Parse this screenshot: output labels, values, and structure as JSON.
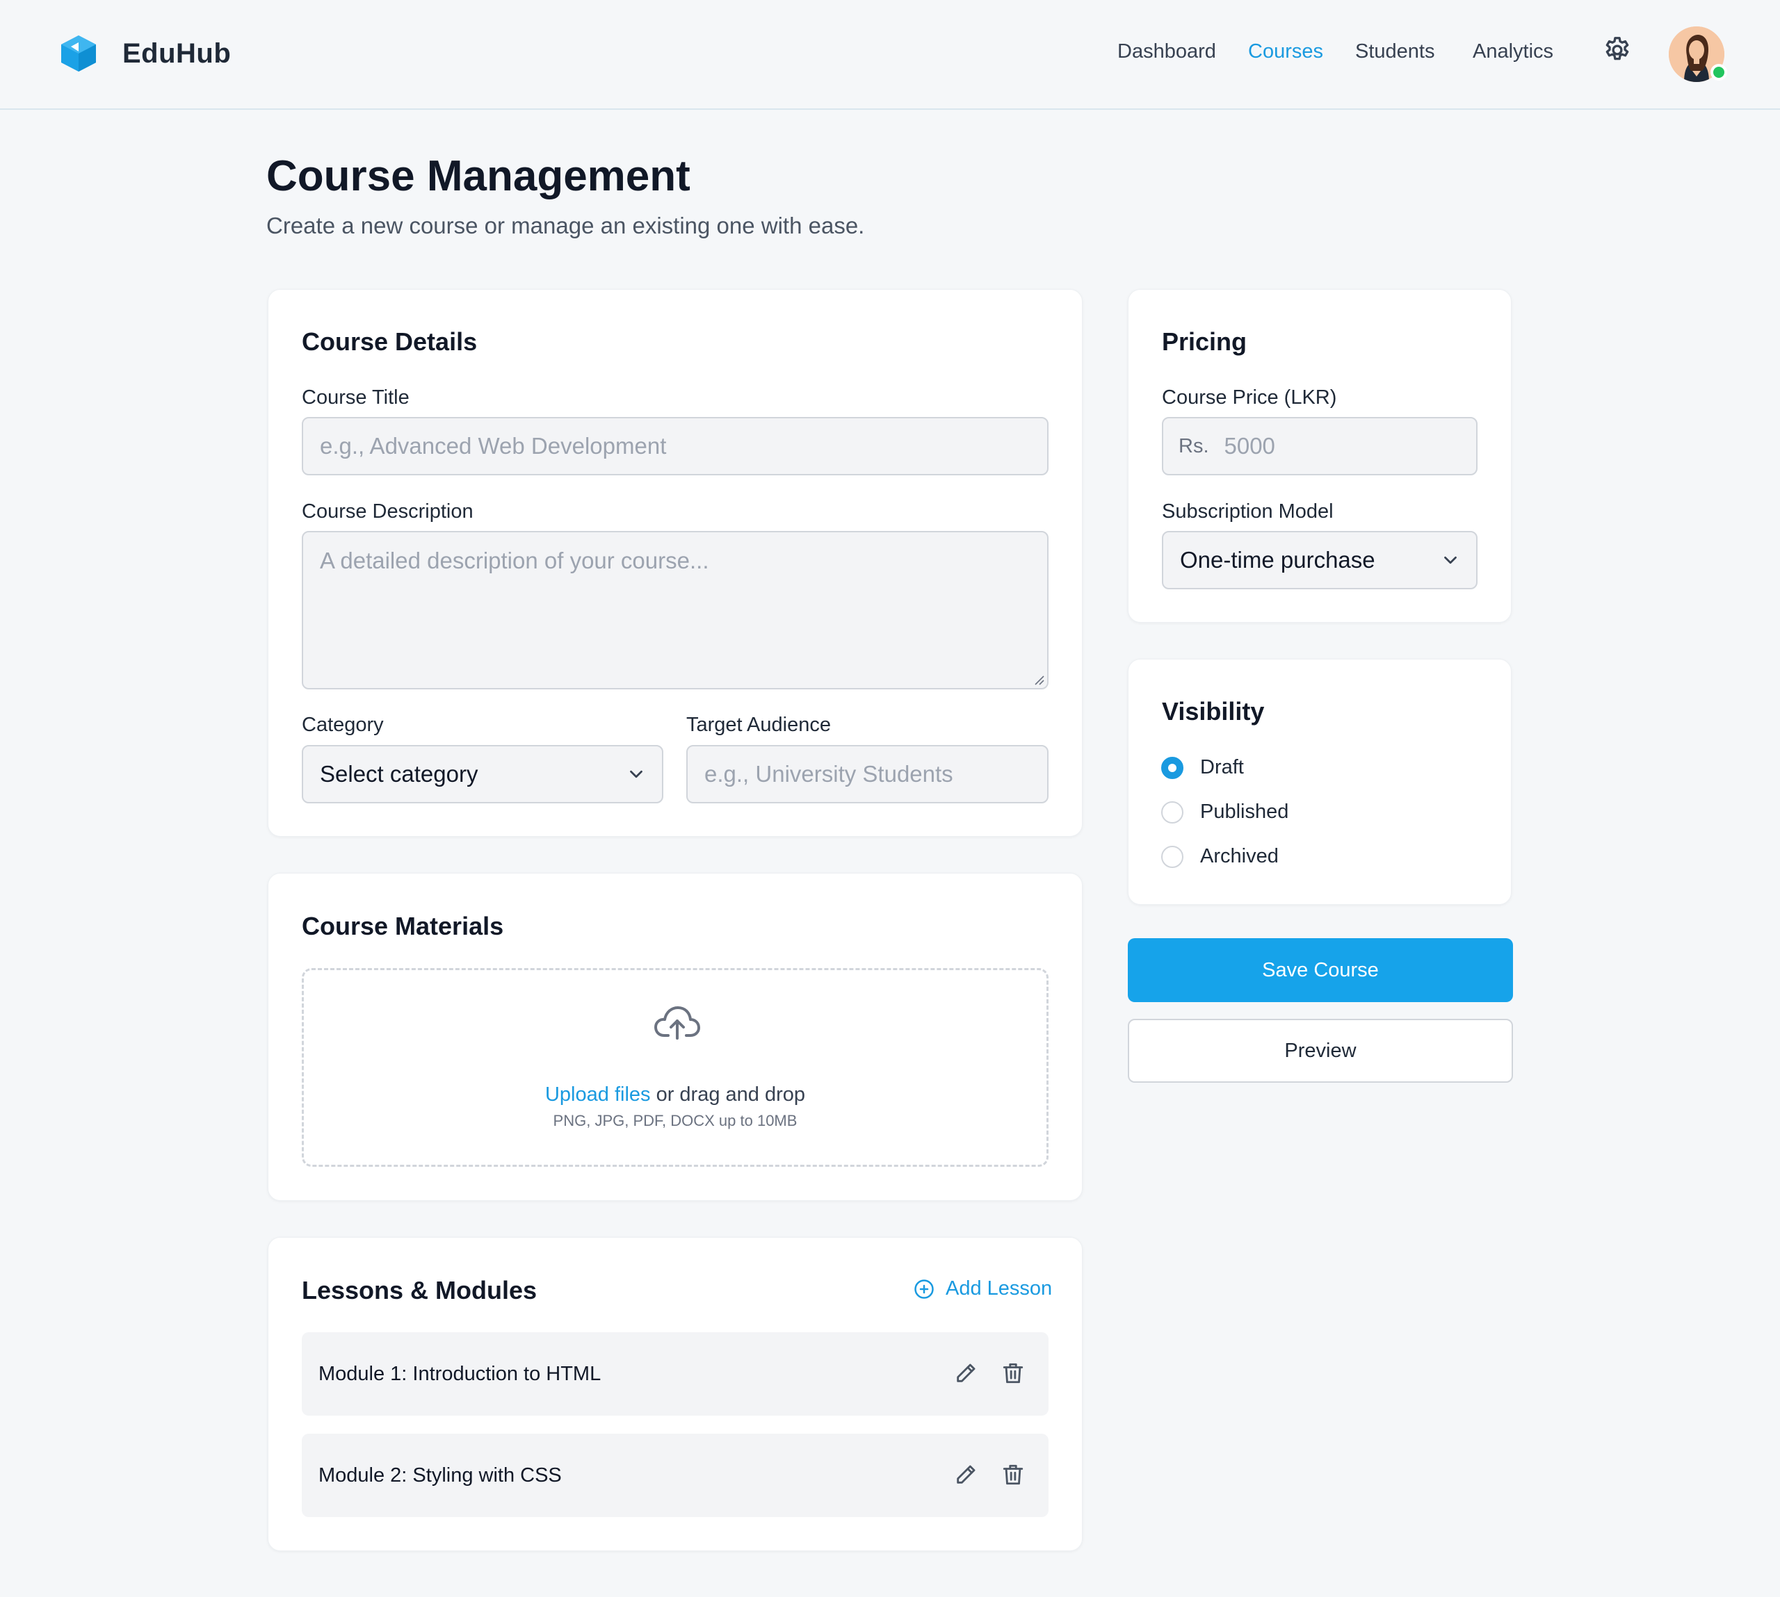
{
  "app": {
    "name": "EduHub"
  },
  "nav": {
    "items": [
      "Dashboard",
      "Courses",
      "Students",
      "Analytics"
    ],
    "active": "Courses"
  },
  "page": {
    "title": "Course Management",
    "subtitle": "Create a new course or manage an existing one with ease."
  },
  "course_details": {
    "title": "Course Details",
    "course_title_label": "Course Title",
    "course_title_placeholder": "e.g., Advanced Web Development",
    "description_label": "Course Description",
    "description_placeholder": "A detailed description of your course...",
    "category_label": "Category",
    "category_value": "Select category",
    "audience_label": "Target Audience",
    "audience_placeholder": "e.g., University Students"
  },
  "materials": {
    "title": "Course Materials",
    "upload_link": "Upload files",
    "upload_text": " or drag and drop",
    "upload_hint": "PNG, JPG, PDF, DOCX up to 10MB"
  },
  "lessons": {
    "title": "Lessons & Modules",
    "add_label": "Add Lesson",
    "items": [
      {
        "title": "Module 1: Introduction to HTML"
      },
      {
        "title": "Module 2: Styling with CSS"
      }
    ]
  },
  "pricing": {
    "title": "Pricing",
    "price_label": "Course Price (LKR)",
    "price_prefix": "Rs.",
    "price_placeholder": "5000",
    "model_label": "Subscription Model",
    "model_value": "One-time purchase"
  },
  "visibility": {
    "title": "Visibility",
    "options": [
      "Draft",
      "Published",
      "Archived"
    ],
    "selected": "Draft"
  },
  "actions": {
    "save_label": "Save Course",
    "preview_label": "Preview"
  },
  "icons": {
    "logo": "cube-logo-icon",
    "settings": "gear-icon",
    "avatar": "user-avatar",
    "chevron": "chevron-down-icon",
    "upload": "cloud-upload-icon",
    "add": "plus-circle-icon",
    "edit": "pencil-icon",
    "delete": "trash-icon"
  },
  "colors": {
    "accent": "#1a9ae0",
    "primary_button": "#16a3ea",
    "online": "#22c55e",
    "background": "#f5f7f9"
  }
}
